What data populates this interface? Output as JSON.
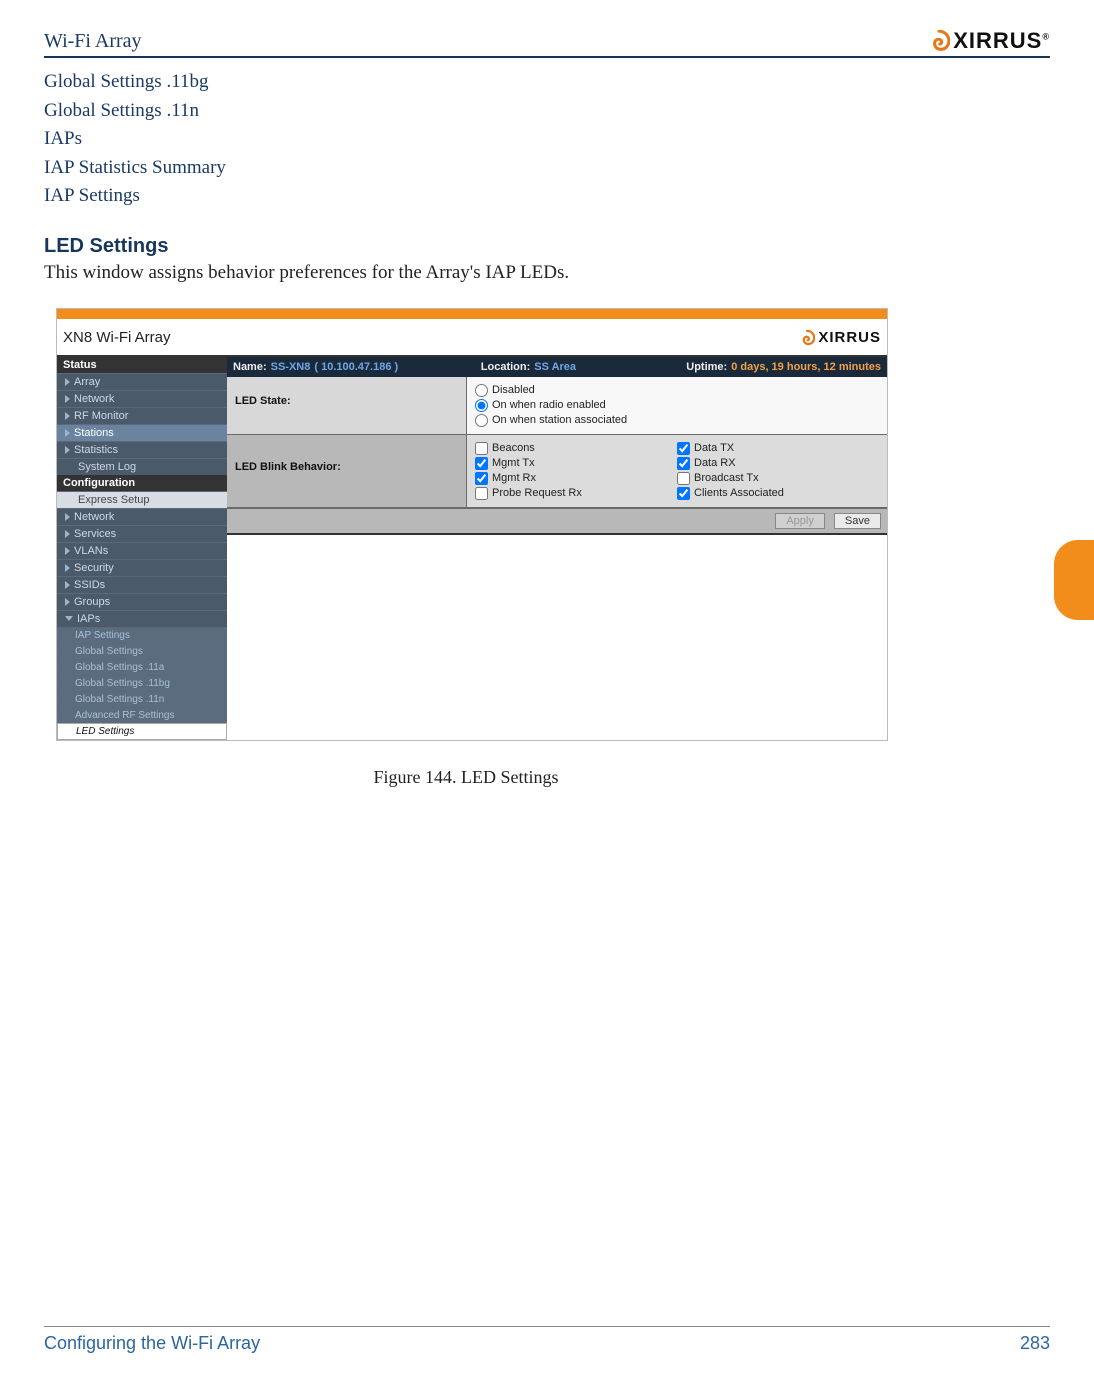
{
  "header": {
    "doc_title": "Wi-Fi Array",
    "brand": "XIRRUS"
  },
  "links": [
    "Global Settings .11bg",
    "Global Settings .11n",
    "IAPs",
    "IAP Statistics Summary",
    "IAP Settings"
  ],
  "section": {
    "heading": "LED Settings",
    "body": "This window assigns behavior preferences for the Array's IAP LEDs."
  },
  "fig": {
    "title": "XN8 Wi-Fi Array",
    "top": {
      "name_lbl": "Name:",
      "name_val": "SS-XN8",
      "ip": "( 10.100.47.186 )",
      "loc_lbl": "Location:",
      "loc_val": "SS Area",
      "uptime_lbl": "Uptime:",
      "uptime_val": "0 days, 19 hours, 12 minutes"
    },
    "sidebar": {
      "status_hdr": "Status",
      "status_items": [
        "Array",
        "Network",
        "RF Monitor"
      ],
      "stations_sel": "Stations",
      "status_items2": [
        "Statistics",
        "System Log"
      ],
      "config_hdr": "Configuration",
      "express": "Express Setup",
      "config_items": [
        "Network",
        "Services",
        "VLANs",
        "Security",
        "SSIDs",
        "Groups"
      ],
      "iaps": "IAPs",
      "iaps_children": [
        "IAP Settings",
        "Global Settings",
        "Global Settings .11a",
        "Global Settings .11bg",
        "Global Settings .11n",
        "Advanced RF Settings"
      ],
      "iaps_sel": "LED Settings"
    },
    "rows": {
      "led_state_lbl": "LED State:",
      "led_state_opts": [
        "Disabled",
        "On when radio enabled",
        "On when station associated"
      ],
      "led_state_selected": 1,
      "blink_lbl": "LED Blink Behavior:",
      "blink_left": [
        {
          "label": "Beacons",
          "checked": false
        },
        {
          "label": "Mgmt Tx",
          "checked": true
        },
        {
          "label": "Mgmt Rx",
          "checked": true
        },
        {
          "label": "Probe Request Rx",
          "checked": false
        }
      ],
      "blink_right": [
        {
          "label": "Data TX",
          "checked": true
        },
        {
          "label": "Data RX",
          "checked": true
        },
        {
          "label": "Broadcast Tx",
          "checked": false
        },
        {
          "label": "Clients Associated",
          "checked": true
        }
      ]
    },
    "buttons": {
      "apply": "Apply",
      "save": "Save"
    },
    "caption": "Figure 144. LED Settings"
  },
  "footer": {
    "left": "Configuring the Wi-Fi Array",
    "right": "283"
  }
}
